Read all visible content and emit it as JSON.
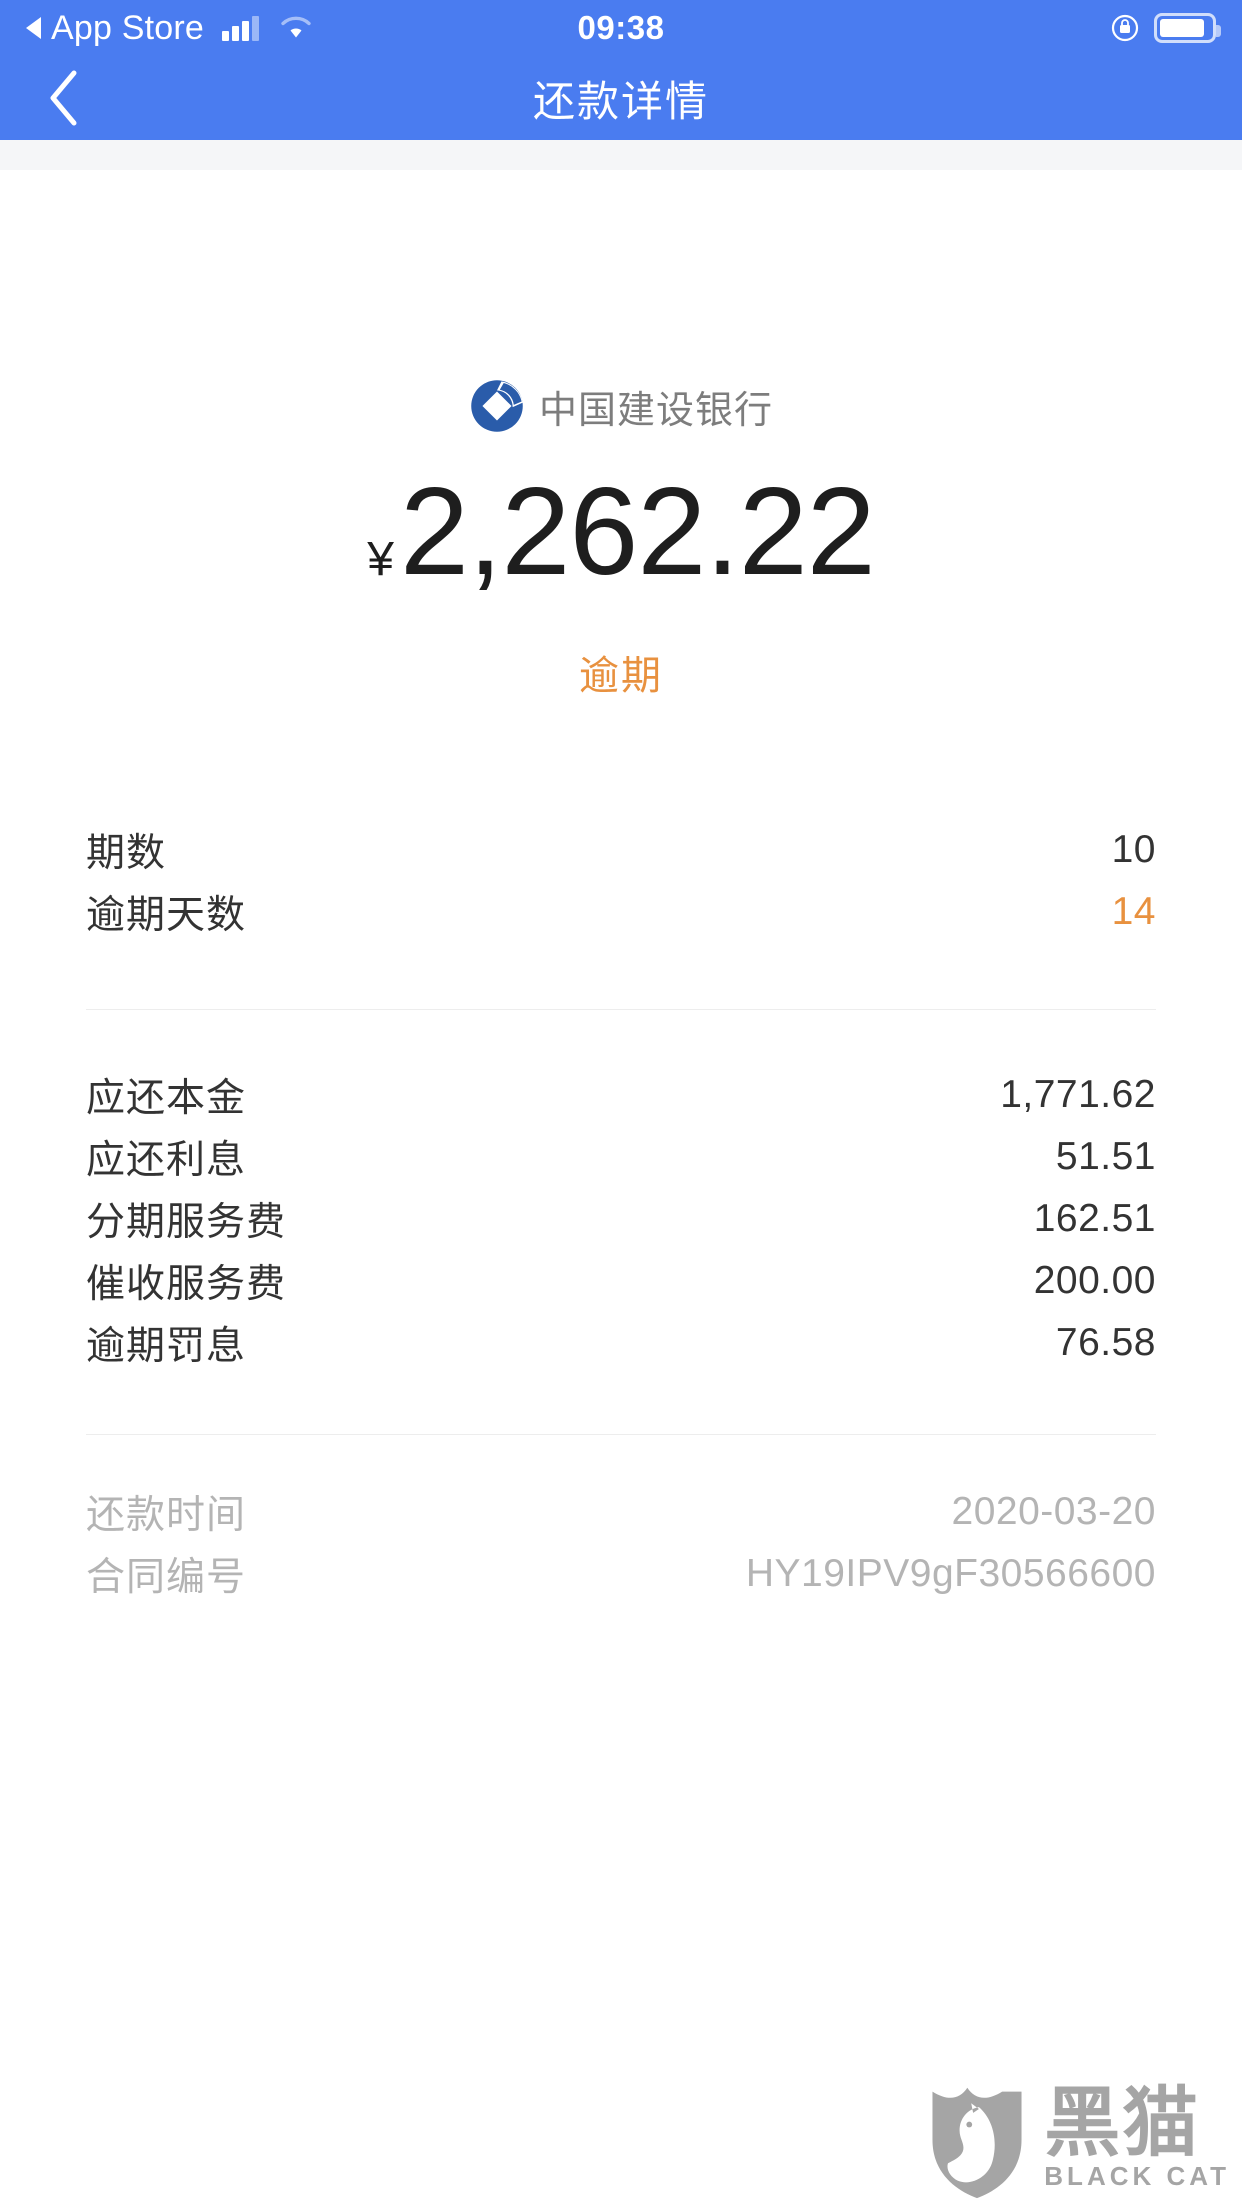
{
  "status_bar": {
    "back_app": "App Store",
    "time": "09:38",
    "signal_icon": "cellular-signal-icon",
    "wifi_icon": "wifi-icon",
    "lock_icon": "rotation-lock-icon",
    "battery_icon": "battery-icon"
  },
  "nav": {
    "back_icon": "chevron-left-icon",
    "title": "还款详情"
  },
  "brand": {
    "logo_icon": "ccb-bank-logo-icon",
    "name": "中国建设银行",
    "logo_color": "#2a5caa"
  },
  "amount": {
    "currency": "¥",
    "value": "2,262.22"
  },
  "status": {
    "label": "逾期",
    "color": "#e8913f"
  },
  "summary_rows": [
    {
      "label": "期数",
      "value": "10",
      "accent": false
    },
    {
      "label": "逾期天数",
      "value": "14",
      "accent": true
    }
  ],
  "breakdown_rows": [
    {
      "label": "应还本金",
      "value": "1,771.62"
    },
    {
      "label": "应还利息",
      "value": "51.51"
    },
    {
      "label": "分期服务费",
      "value": "162.51"
    },
    {
      "label": "催收服务费",
      "value": "200.00"
    },
    {
      "label": "逾期罚息",
      "value": "76.58"
    }
  ],
  "meta_rows": [
    {
      "label": "还款时间",
      "value": "2020-03-20"
    },
    {
      "label": "合同编号",
      "value": "HY19IPV9gF30566600"
    }
  ],
  "watermark": {
    "icon": "black-cat-shield-icon",
    "cn": "黑猫",
    "en": "BLACK CAT"
  },
  "colors": {
    "header_blue": "#4a7cf0",
    "accent_orange": "#e8913f",
    "text_dark": "#333333",
    "text_muted": "#b4b4b4"
  }
}
